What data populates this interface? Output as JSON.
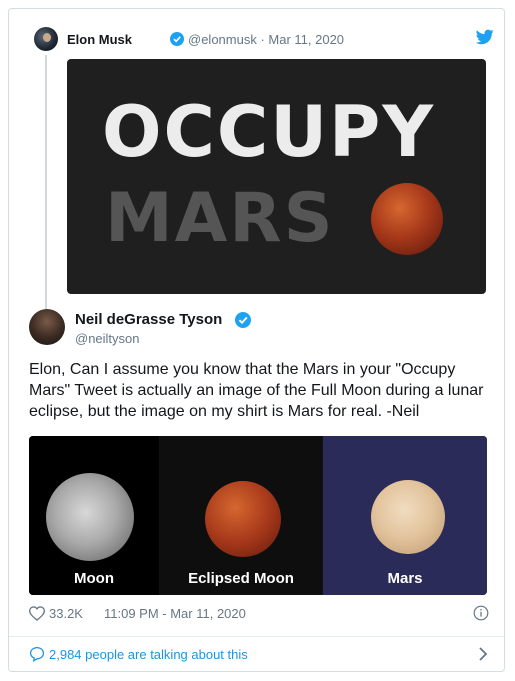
{
  "quoted_tweet": {
    "author_name": "Elon Musk",
    "handle_and_date": "@elonmusk · Mar 11, 2020",
    "image_text_line1": "OCCUPY",
    "image_text_line2": "MARS"
  },
  "tweet": {
    "author_name": "Neil deGrasse Tyson",
    "handle": "@neiltyson",
    "text": "Elon, Can I assume you know that the Mars in your \"Occupy Mars\" Tweet is actually an image of the Full Moon during a lunar eclipse, but the image on my shirt is Mars for real. -Neil",
    "image_labels": [
      "Moon",
      "Eclipsed Moon",
      "Mars"
    ],
    "likes": "33.2K",
    "timestamp": "11:09 PM - Mar 11, 2020"
  },
  "footer": {
    "talking": "2,984 people are talking about this"
  },
  "colors": {
    "accent": "#1da1f2",
    "link": "#1b95e0",
    "muted": "#657786"
  }
}
